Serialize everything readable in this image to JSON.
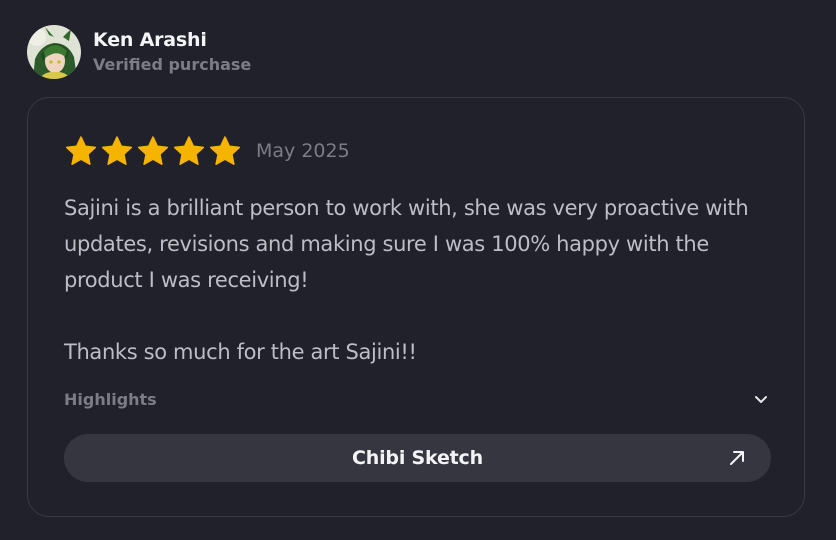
{
  "reviewer": {
    "name": "Ken Arashi",
    "status": "Verified purchase",
    "avatar_icon": "anime-character-avatar"
  },
  "review": {
    "rating": 5,
    "rating_max": 5,
    "star_color": "#f5b400",
    "date": "May 2025",
    "paragraphs": [
      "Sajini is a brilliant person to work with, she was very proactive with updates, revisions and making sure I was 100% happy with the product I was receiving!",
      "Thanks so much for the art Sajini!!"
    ]
  },
  "highlights": {
    "label": "Highlights",
    "toggle_icon": "chevron-down-icon"
  },
  "product": {
    "label": "Chibi Sketch",
    "link_icon": "arrow-up-right-icon"
  },
  "colors": {
    "background": "#21212b",
    "card_border": "#393944",
    "button_bg": "#363640",
    "text_primary": "#f4f4f6",
    "text_secondary": "#7c7c86",
    "text_body": "#bdbdc6"
  }
}
